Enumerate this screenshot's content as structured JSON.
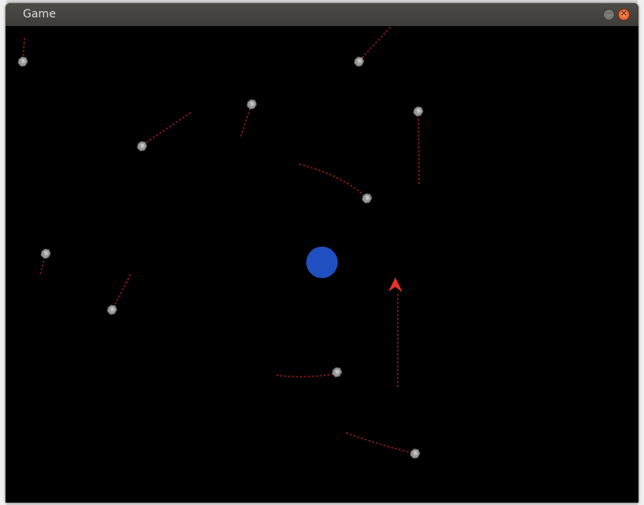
{
  "window": {
    "title": "Game"
  },
  "controls": {
    "minimize_icon": "–",
    "close_icon": "×"
  },
  "game": {
    "background": "#000000",
    "planet_color": "#1f4fc0",
    "player_color": "#e8302a",
    "enemy_color": "#8c8c8c",
    "trail_color": "#7a1a12"
  }
}
